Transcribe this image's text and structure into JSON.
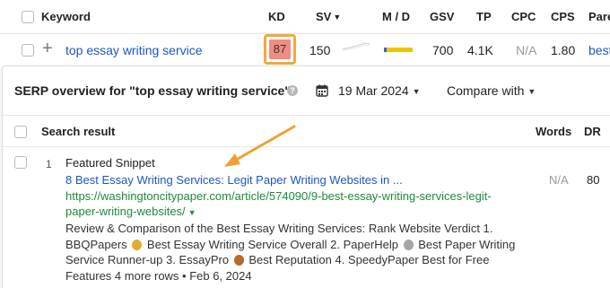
{
  "table_header": {
    "keyword": "Keyword",
    "kd": "KD",
    "sv": "SV",
    "md": "M / D",
    "gsv": "GSV",
    "tp": "TP",
    "cpc": "CPC",
    "cps": "CPS",
    "parent": "Pare"
  },
  "keyword_row": {
    "keyword": "top essay writing service",
    "kd": "87",
    "sv": "150",
    "gsv": "700",
    "tp": "4.1K",
    "cpc": "N/A",
    "cps": "1.80",
    "parent": "best"
  },
  "serp": {
    "title": "SERP overview for \"top essay writing service\"",
    "date": "19 Mar 2024",
    "compare_label": "Compare with",
    "columns": {
      "search_result": "Search result",
      "words": "Words",
      "dr": "DR"
    },
    "results": [
      {
        "rank": "1",
        "type": "Featured Snippet",
        "title": "8 Best Essay Writing Services: Legit Paper Writing Websites in ...",
        "url": "https://washingtoncitypaper.com/article/574090/9-best-essay-writing-services-legit-paper-writing-websites/",
        "desc_1": "Review & Comparison of the Best Essay Writing Services: Rank Website Verdict 1. BBQPapers",
        "desc_2": "Best Essay Writing Service Overall 2. PaperHelp",
        "desc_3": "Best Paper Writing Service Runner-up 3. EssayPro",
        "desc_4": "Best Reputation 4. SpeedyPaper Best for Free Features 4 more rows • Feb 6, 2024",
        "words": "N/A",
        "dr": "80"
      }
    ]
  },
  "colors": {
    "link": "#1a56c9",
    "url_green": "#1f8a3a",
    "kd_fill": "#ef8d82",
    "highlight_border": "#f2a93b",
    "arrow": "#f0a030"
  }
}
